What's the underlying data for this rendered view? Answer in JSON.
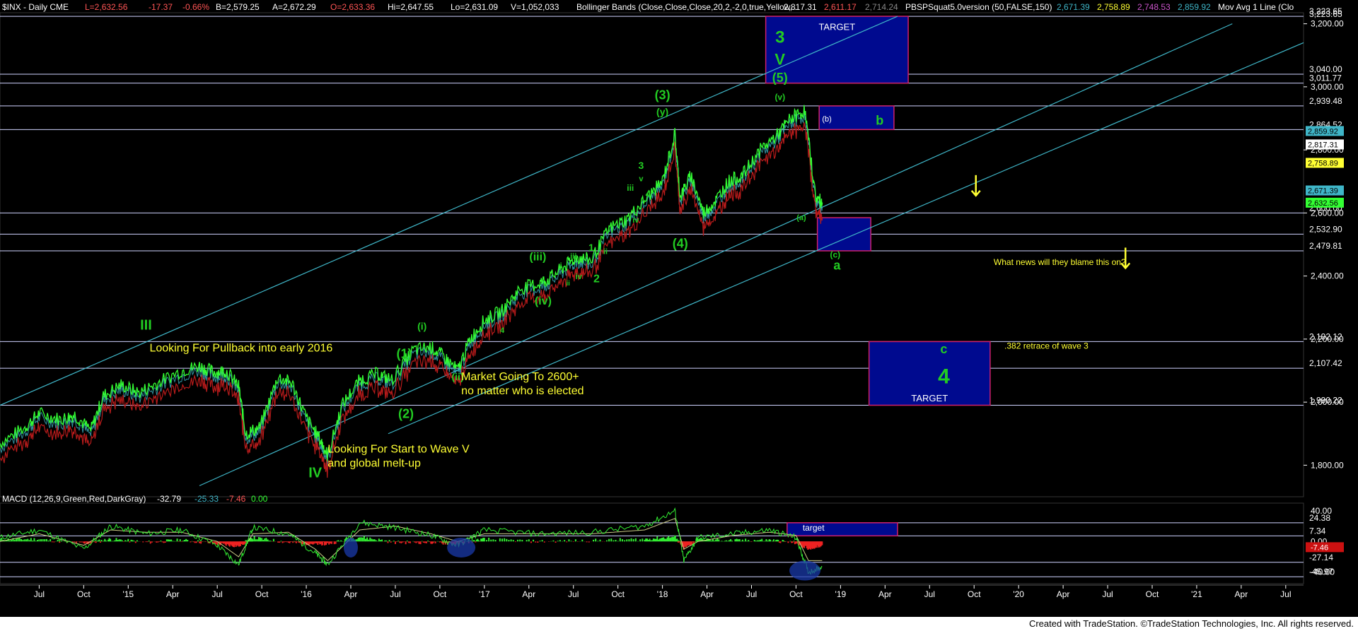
{
  "header": {
    "symbol": "$INX - Daily  CME",
    "last": "L=2,632.56",
    "change": "-17.37",
    "change_pct": "-0.66%",
    "bid": "B=2,579.25",
    "ask": "A=2,672.29",
    "open": "O=2,633.36",
    "high": "Hi=2,647.55",
    "low": "Lo=2,631.09",
    "volume": "V=1,052,033",
    "bb_label": "Bollinger Bands (Close,Close,Close,20,2,-2,0,true,Yellow,...",
    "bb_v1": "2,817.31",
    "bb_v2": "2,611.17",
    "bb_v3": "2,714.24",
    "ind_label": "PBSPSquat5.0version (50,FALSE,150)",
    "ind_v1": "2,671.39",
    "ind_v2": "2,758.89",
    "ind_v3": "2,748.53",
    "ind_v4": "2,859.92",
    "ma_label": "Mov Avg 1 Line (Clo"
  },
  "colors": {
    "background": "#000000",
    "price": "#33ff33",
    "channel": "#3fb6c8",
    "hline": "#cfd3ff",
    "target_box": "#000a8f",
    "target_border": "#d0206a",
    "wave_label": "#22cc22",
    "annotation": "#ffff33",
    "bb_red": "#b81b1b",
    "macd_green": "#33ee33",
    "macd_red": "#ee2222",
    "macd_signal": "#cccc88"
  },
  "chart_data": {
    "type": "line",
    "title": "$INX - Daily  CME",
    "ylim": [
      1700,
      3235
    ],
    "y_ticks": [
      "3,200.00",
      "3,000.00",
      "2,800.00",
      "2,600.00",
      "2,400.00",
      "2,200.00",
      "2,000.00",
      "1,800.00"
    ],
    "y_tick_values": [
      3200,
      3000,
      2800,
      2600,
      2400,
      2200,
      2000,
      1800
    ],
    "x_ticks": [
      "Jul",
      "Oct",
      "'15",
      "Apr",
      "Jul",
      "Oct",
      "'16",
      "Apr",
      "Jul",
      "Oct",
      "'17",
      "Apr",
      "Jul",
      "Oct",
      "'18",
      "Apr",
      "Jul",
      "Oct",
      "'19",
      "Apr",
      "Jul",
      "Oct",
      "'20",
      "Apr",
      "Jul",
      "Oct",
      "'21",
      "Apr",
      "Jul"
    ],
    "x_tick_values": [
      2014.5,
      2014.75,
      2015.0,
      2015.25,
      2015.5,
      2015.75,
      2016.0,
      2016.25,
      2016.5,
      2016.75,
      2017.0,
      2017.25,
      2017.5,
      2017.75,
      2018.0,
      2018.25,
      2018.5,
      2018.75,
      2019.0,
      2019.25,
      2019.5,
      2019.75,
      2020.0,
      2020.25,
      2020.5,
      2020.75,
      2021.0,
      2021.25,
      2021.5
    ],
    "xlim": [
      2014.28,
      2021.6
    ],
    "series": [
      {
        "x": [
          2014.28,
          2014.42,
          2014.5,
          2014.62,
          2014.7,
          2014.79,
          2014.86,
          2014.96,
          2015.06,
          2015.16,
          2015.3,
          2015.4,
          2015.48,
          2015.55,
          2015.62,
          2015.66,
          2015.74,
          2015.84,
          2015.92,
          2016.0,
          2016.08,
          2016.12,
          2016.2,
          2016.3,
          2016.4,
          2016.48,
          2016.6,
          2016.7,
          2016.78,
          2016.85,
          2016.92,
          2017.0,
          2017.1,
          2017.2,
          2017.3,
          2017.36,
          2017.45,
          2017.52,
          2017.6,
          2017.7,
          2017.8,
          2017.9,
          2018.0,
          2018.07,
          2018.1,
          2018.16,
          2018.23,
          2018.3,
          2018.37,
          2018.45,
          2018.55,
          2018.65,
          2018.72,
          2018.8,
          2018.86,
          2018.9
        ],
        "values": [
          1870,
          1920,
          1965,
          1945,
          1960,
          1910,
          2020,
          2055,
          2030,
          2060,
          2100,
          2115,
          2095,
          2100,
          2050,
          1900,
          1920,
          2080,
          2060,
          1950,
          1880,
          1830,
          1990,
          2070,
          2090,
          2070,
          2165,
          2175,
          2140,
          2100,
          2200,
          2260,
          2290,
          2360,
          2375,
          2390,
          2430,
          2460,
          2450,
          2550,
          2580,
          2640,
          2700,
          2850,
          2650,
          2720,
          2600,
          2640,
          2700,
          2720,
          2800,
          2850,
          2900,
          2925,
          2650,
          2632
        ]
      }
    ],
    "h_levels": [
      3223.65,
      3040.0,
      3011.77,
      2939.48,
      2864.52,
      2600.0,
      2532.9,
      2479.81,
      2192.12,
      2107.42,
      1990.22
    ],
    "h_level_labels": [
      "3,223.65",
      "3,040.00",
      "3,011.77",
      "2,939.48",
      "2,864.52",
      "2,600.00",
      "2,532.90",
      "2,479.81",
      "2,192.12",
      "2,107.42",
      "1,990.22"
    ],
    "price_tags": [
      {
        "label": "2,859.92",
        "value": 2859.92,
        "bg": "#3fb6c8",
        "fg": "#000000"
      },
      {
        "label": "2,817.31",
        "value": 2817.31,
        "bg": "#ffffff",
        "fg": "#000000"
      },
      {
        "label": "2,758.89",
        "value": 2758.89,
        "bg": "#ffff33",
        "fg": "#000000"
      },
      {
        "label": "2,671.39",
        "value": 2671.39,
        "bg": "#3fb6c8",
        "fg": "#000000"
      },
      {
        "label": "2,632.56",
        "value": 2632.56,
        "bg": "#33ff33",
        "fg": "#000000"
      }
    ],
    "boxes": [
      {
        "x0": 2018.58,
        "x1": 2019.38,
        "y0": 3011.77,
        "y1": 3223.65,
        "label": "TARGET"
      },
      {
        "x0": 2018.88,
        "x1": 2019.3,
        "y0": 2864.52,
        "y1": 2939.48,
        "label": "(b)"
      },
      {
        "x0": 2018.87,
        "x1": 2019.17,
        "y0": 2479.81,
        "y1": 2585.0,
        "label": ""
      },
      {
        "x0": 2019.16,
        "x1": 2019.84,
        "y0": 1990.22,
        "y1": 2192.12,
        "label": "TARGET"
      }
    ],
    "channels": [
      {
        "x0": 2014.28,
        "y0": 1990,
        "x1": 2019.32,
        "y1": 3223.65
      },
      {
        "x0": 2015.4,
        "y0": 1735,
        "x1": 2021.2,
        "y1": 3200
      },
      {
        "x0": 2016.46,
        "y0": 1900,
        "x1": 2021.6,
        "y1": 3140
      }
    ],
    "wave_labels": [
      {
        "text": "III",
        "x": 2015.1,
        "y": 2230,
        "size": 20
      },
      {
        "text": "IV",
        "x": 2016.05,
        "y": 1762,
        "size": 20
      },
      {
        "text": "3",
        "x": 2018.66,
        "y": 3140,
        "size": 24
      },
      {
        "text": "V",
        "x": 2018.66,
        "y": 3070,
        "size": 22
      },
      {
        "text": "(5)",
        "x": 2018.66,
        "y": 3015,
        "size": 18
      },
      {
        "text": "(v)",
        "x": 2018.66,
        "y": 2958,
        "size": 12
      },
      {
        "text": "(3)",
        "x": 2018.0,
        "y": 2960,
        "size": 18
      },
      {
        "text": "(y)",
        "x": 2018.0,
        "y": 2910,
        "size": 14
      },
      {
        "text": "(4)",
        "x": 2018.1,
        "y": 2490,
        "size": 18
      },
      {
        "text": "(1)",
        "x": 2016.55,
        "y": 2140,
        "size": 18
      },
      {
        "text": "(2)",
        "x": 2016.56,
        "y": 1950,
        "size": 18
      },
      {
        "text": "(i)",
        "x": 2016.65,
        "y": 2230,
        "size": 14
      },
      {
        "text": "(ii)",
        "x": 2016.85,
        "y": 2070,
        "size": 14
      },
      {
        "text": "(iii)",
        "x": 2017.3,
        "y": 2450,
        "size": 16
      },
      {
        "text": "(iv)",
        "x": 2017.33,
        "y": 2310,
        "size": 16
      },
      {
        "text": "(a)",
        "x": 2018.78,
        "y": 2577,
        "size": 11
      },
      {
        "text": "(c)",
        "x": 2018.97,
        "y": 2458,
        "size": 12
      },
      {
        "text": "a",
        "x": 2018.98,
        "y": 2420,
        "size": 18
      },
      {
        "text": "b",
        "x": 2019.22,
        "y": 2880,
        "size": 18
      },
      {
        "text": "c",
        "x": 2019.58,
        "y": 2155,
        "size": 18
      },
      {
        "text": "4",
        "x": 2019.58,
        "y": 2060,
        "size": 30
      },
      {
        "text": "1",
        "x": 2017.6,
        "y": 2480,
        "size": 14
      },
      {
        "text": "2",
        "x": 2017.63,
        "y": 2380,
        "size": 16
      },
      {
        "text": "3",
        "x": 2017.88,
        "y": 2740,
        "size": 14
      },
      {
        "text": "4",
        "x": 2017.92,
        "y": 2650,
        "size": 14
      },
      {
        "text": "iii",
        "x": 2017.82,
        "y": 2670,
        "size": 12
      },
      {
        "text": "iv",
        "x": 2017.85,
        "y": 2570,
        "size": 11
      },
      {
        "text": "v",
        "x": 2017.88,
        "y": 2700,
        "size": 11
      },
      {
        "text": "i",
        "x": 2017.7,
        "y": 2540,
        "size": 11
      },
      {
        "text": "ii",
        "x": 2017.68,
        "y": 2470,
        "size": 11
      },
      {
        "text": "iii",
        "x": 2017.5,
        "y": 2455,
        "size": 11
      },
      {
        "text": "iv",
        "x": 2017.53,
        "y": 2390,
        "size": 11
      },
      {
        "text": "i",
        "x": 2017.43,
        "y": 2425,
        "size": 11
      },
      {
        "text": "ii",
        "x": 2017.47,
        "y": 2370,
        "size": 10
      },
      {
        "text": "4",
        "x": 2017.1,
        "y": 2220,
        "size": 11
      }
    ],
    "annotations": [
      {
        "text": "Looking For Pullback into early 2016",
        "x": 2015.12,
        "y": 2160,
        "size": 16
      },
      {
        "text": "Market Going To 2600+",
        "x": 2016.87,
        "y": 2070,
        "size": 16
      },
      {
        "text": "no matter who is elected",
        "x": 2016.87,
        "y": 2025,
        "size": 16
      },
      {
        "text": "Looking For Start to Wave V",
        "x": 2016.12,
        "y": 1840,
        "size": 16
      },
      {
        "text": "and global melt-up",
        "x": 2016.12,
        "y": 1795,
        "size": 16
      },
      {
        "text": "What news will they blame this on?",
        "x": 2019.86,
        "y": 2435,
        "size": 12
      },
      {
        "text": ".382 retrace of wave 3",
        "x": 2019.92,
        "y": 2170,
        "size": 12
      }
    ],
    "arrows": [
      {
        "x": 2019.76,
        "y0": 2720,
        "y1": 2655
      },
      {
        "x": 2020.6,
        "y0": 2490,
        "y1": 2425
      }
    ],
    "macd": {
      "label": "MACD (12,26,9,Green,Red,DarkGray)",
      "v1": "-32.79",
      "v2": "-25.33",
      "v3": "-7.46",
      "v4": "0.00",
      "ylim": [
        -55,
        50
      ],
      "y_ticks": [
        "40.00",
        "0.00",
        "-40.00"
      ],
      "y_tick_values": [
        40,
        0,
        -40
      ],
      "h_levels": [
        24.38,
        7.34,
        -27.14,
        -45.97
      ],
      "h_level_labels": [
        "24.38",
        "7.34",
        "-27.14",
        "-45.97"
      ],
      "current_tag": "-7.46",
      "target_box": {
        "x0": 2018.7,
        "x1": 2019.32,
        "y0": 7.34,
        "y1": 24.38,
        "label": "target"
      },
      "x": [
        2014.28,
        2014.5,
        2014.75,
        2014.9,
        2015.1,
        2015.3,
        2015.5,
        2015.62,
        2015.7,
        2015.9,
        2016.05,
        2016.12,
        2016.3,
        2016.5,
        2016.7,
        2016.85,
        2017.0,
        2017.3,
        2017.6,
        2017.9,
        2018.07,
        2018.12,
        2018.2,
        2018.4,
        2018.6,
        2018.75,
        2018.82,
        2018.9
      ],
      "values": [
        5,
        15,
        -10,
        20,
        10,
        15,
        -5,
        -30,
        18,
        10,
        -15,
        -30,
        25,
        18,
        8,
        -5,
        15,
        10,
        12,
        20,
        40,
        -25,
        5,
        10,
        15,
        5,
        -40,
        -33
      ],
      "signal": [
        0,
        10,
        -5,
        15,
        12,
        12,
        0,
        -20,
        10,
        12,
        -10,
        -25,
        15,
        20,
        10,
        0,
        10,
        10,
        10,
        15,
        30,
        -10,
        0,
        8,
        12,
        8,
        -25,
        -25
      ]
    }
  },
  "footer": {
    "credit": "Created with TradeStation. ©TradeStation Technologies, Inc. All rights reserved."
  }
}
